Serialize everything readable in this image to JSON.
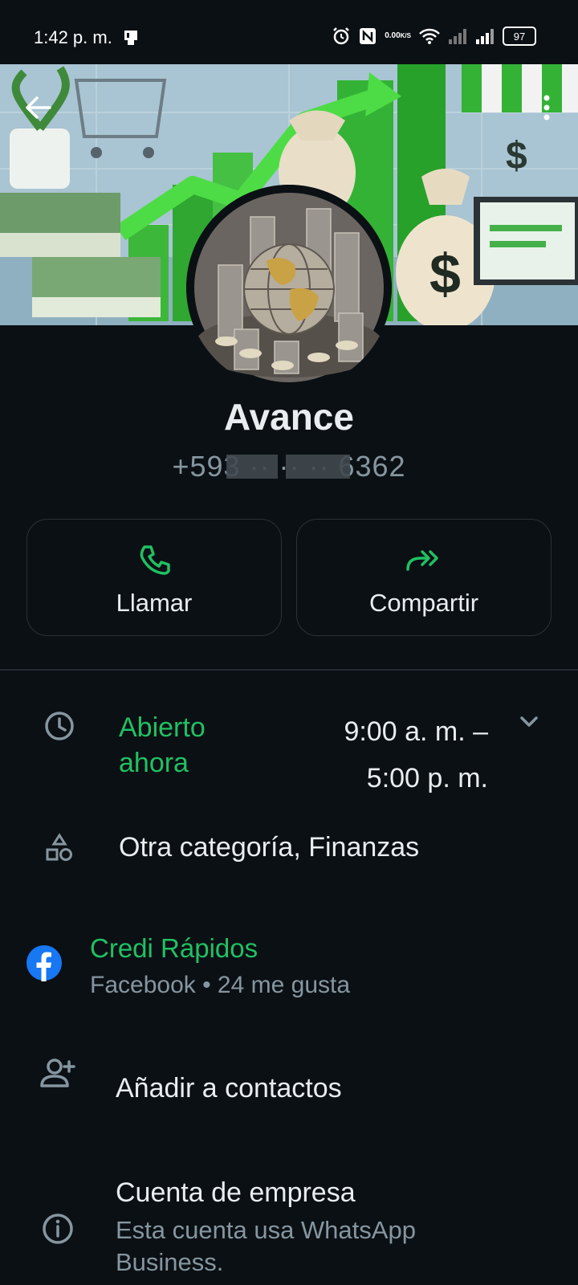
{
  "status_bar": {
    "time": "1:42 p. m.",
    "net_speed_value": "0.00",
    "net_speed_unit": "K/S",
    "battery": "97",
    "icons": [
      "notification-icon",
      "alarm-icon",
      "nfc-icon",
      "wifi-icon",
      "signal-icon",
      "signal-icon",
      "battery-icon"
    ]
  },
  "header": {
    "back_icon": "arrow-left-icon",
    "menu_icon": "more-vert-icon"
  },
  "profile": {
    "name": "Avance",
    "phone": "+593 ·· ·· ·· 6362"
  },
  "actions": [
    {
      "label": "Llamar",
      "icon": "phone-icon"
    },
    {
      "label": "Compartir",
      "icon": "forward-icon"
    }
  ],
  "hours": {
    "status": "Abierto ahora",
    "time_start": "9:00 a. m. –",
    "time_end": "5:00 p. m."
  },
  "category": "Otra categoría, Finanzas",
  "facebook": {
    "title": "Credi Rápidos",
    "subtitle": "Facebook • 24 me gusta"
  },
  "add_contact": "Añadir a contactos",
  "business": {
    "title": "Cuenta de empresa",
    "subtitle": "Esta cuenta usa WhatsApp Business."
  },
  "colors": {
    "background": "#0b1014",
    "accent_green": "#21c063",
    "secondary_text": "#8696a0",
    "facebook_blue": "#1877f2"
  }
}
